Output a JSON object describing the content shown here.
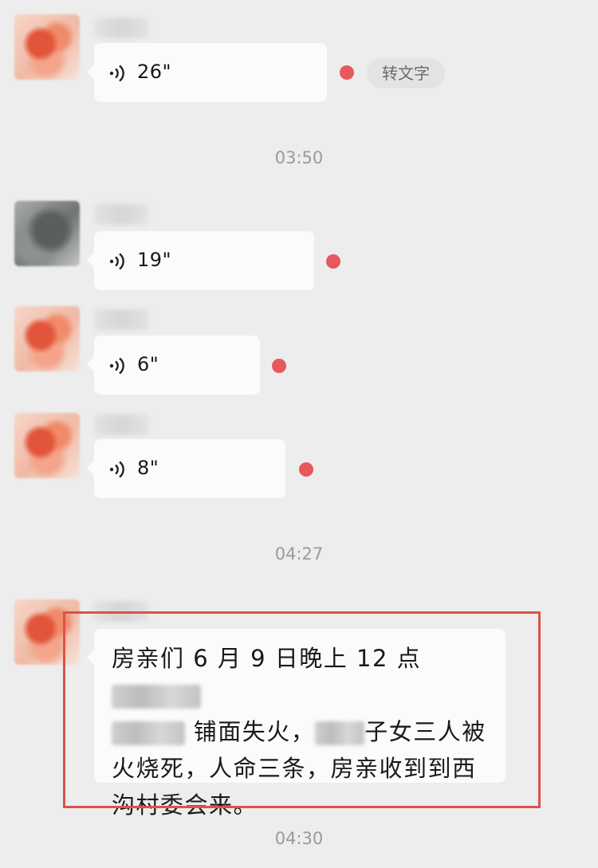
{
  "messages": [
    {
      "type": "voice",
      "duration": "26\"",
      "avatar": "orange-avatar",
      "unread": true,
      "convert_label": "转文字"
    },
    {
      "type": "timestamp",
      "text": "03:50"
    },
    {
      "type": "voice",
      "duration": "19\"",
      "avatar": "gray-avatar",
      "unread": true
    },
    {
      "type": "voice",
      "duration": "6\"",
      "avatar": "orange-avatar",
      "unread": true
    },
    {
      "type": "voice",
      "duration": "8\"",
      "avatar": "orange-avatar",
      "unread": true
    },
    {
      "type": "timestamp",
      "text": "04:27"
    },
    {
      "type": "text",
      "line1": "房亲们 6 月 9 日晚上 12 点",
      "line2a": "铺面失火，",
      "line2b": "子女三人被",
      "line3": "火烧死，人命三条，房亲收到到西",
      "line4": "沟村委会来。",
      "avatar": "orange-avatar"
    },
    {
      "type": "timestamp",
      "text": "04:30"
    }
  ],
  "icons": {
    "voice": "voice-wave-icon"
  },
  "colors": {
    "background": "#ededed",
    "bubble": "#fbfbfb",
    "unread_dot": "#e6585c",
    "highlight_border": "#d9534b"
  }
}
